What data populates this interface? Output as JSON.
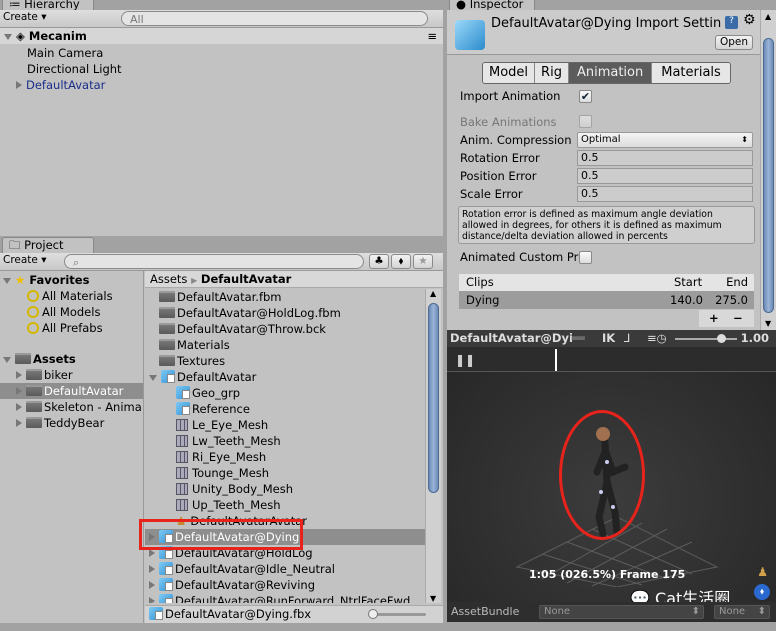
{
  "hierarchy": {
    "tab": "Hierarchy",
    "create": "Create ▾",
    "search_placeholder": "All",
    "scene": "Mecanim",
    "items": [
      "Main Camera",
      "Directional Light",
      "DefaultAvatar"
    ]
  },
  "project": {
    "tab": "Project",
    "create": "Create ▾",
    "favorites": "Favorites",
    "favorite_items": [
      "All Materials",
      "All Models",
      "All Prefabs"
    ],
    "assets": "Assets",
    "asset_folders": [
      "biker",
      "DefaultAvatar",
      "Skeleton - Anima",
      "TeddyBear"
    ],
    "breadcrumb": [
      "Assets",
      "DefaultAvatar"
    ],
    "files": [
      {
        "label": "DefaultAvatar.fbm",
        "icon": "folder",
        "indent": 0
      },
      {
        "label": "DefaultAvatar@HoldLog.fbm",
        "icon": "folder",
        "indent": 0
      },
      {
        "label": "DefaultAvatar@Throw.bck",
        "icon": "folder",
        "indent": 0
      },
      {
        "label": "Materials",
        "icon": "folder",
        "indent": 0
      },
      {
        "label": "Textures",
        "icon": "folder",
        "indent": 0
      },
      {
        "label": "DefaultAvatar",
        "icon": "model",
        "indent": 0,
        "expanded": true
      },
      {
        "label": "Geo_grp",
        "icon": "model",
        "indent": 1
      },
      {
        "label": "Reference",
        "icon": "model",
        "indent": 1
      },
      {
        "label": "Le_Eye_Mesh",
        "icon": "mesh",
        "indent": 1
      },
      {
        "label": "Lw_Teeth_Mesh",
        "icon": "mesh",
        "indent": 1
      },
      {
        "label": "Ri_Eye_Mesh",
        "icon": "mesh",
        "indent": 1
      },
      {
        "label": "Tounge_Mesh",
        "icon": "mesh",
        "indent": 1
      },
      {
        "label": "Unity_Body_Mesh",
        "icon": "mesh",
        "indent": 1
      },
      {
        "label": "Up_Teeth_Mesh",
        "icon": "mesh",
        "indent": 1
      },
      {
        "label": "DefaultAvatarAvatar",
        "icon": "avatar",
        "indent": 1
      },
      {
        "label": "DefaultAvatar@Dying",
        "icon": "model",
        "indent": 0,
        "selected": true
      },
      {
        "label": "DefaultAvatar@HoldLog",
        "icon": "model",
        "indent": 0
      },
      {
        "label": "DefaultAvatar@Idle_Neutral",
        "icon": "model",
        "indent": 0
      },
      {
        "label": "DefaultAvatar@Reviving",
        "icon": "model",
        "indent": 0
      },
      {
        "label": "DefaultAvatar@RunForward_NtrlFaceFwd",
        "icon": "model",
        "indent": 0
      }
    ],
    "status_file": "DefaultAvatar@Dying.fbx"
  },
  "inspector": {
    "tab": "Inspector",
    "title": "DefaultAvatar@Dying Import Setting",
    "open": "Open",
    "tabs": [
      "Model",
      "Rig",
      "Animation",
      "Materials"
    ],
    "active_tab": "Animation",
    "import_animation": "Import Animation",
    "bake_animations": "Bake Animations",
    "anim_compression": "Anim. Compression",
    "compression_value": "Optimal",
    "rotation_error": "Rotation Error",
    "rotation_value": "0.5",
    "position_error": "Position Error",
    "position_value": "0.5",
    "scale_error": "Scale Error",
    "scale_value": "0.5",
    "help": "Rotation error is defined as maximum angle deviation allowed in degrees, for others it is defined as maximum distance/delta deviation allowed in percents",
    "animated_custom": "Animated Custom Pr",
    "clips_header": [
      "Clips",
      "Start",
      "End"
    ],
    "clip": {
      "name": "Dying",
      "start": "140.0",
      "end": "275.0"
    },
    "plus": "+",
    "minus": "−"
  },
  "preview": {
    "title": "DefaultAvatar@Dyi",
    "ik": "IK",
    "speed": "1.00",
    "speed_fraction": 0.45,
    "status": "1:05 (026.5%) Frame 175",
    "watermark": "Cat生活圈"
  },
  "assetbundle": {
    "label": "AssetBundle",
    "value1": "None",
    "value2": "None"
  }
}
